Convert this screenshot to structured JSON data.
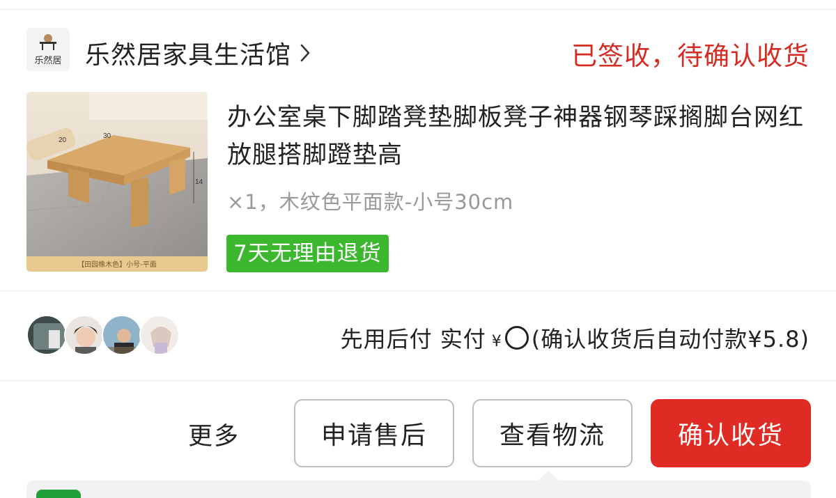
{
  "shop": {
    "logo_text": "乐然居",
    "name": "乐然居家具生活馆",
    "chevron_icon": "chevron-right-icon",
    "status": "已签收，待确认收货"
  },
  "product": {
    "title": "办公室桌下脚踏凳垫脚板凳子神器钢琴踩搁脚台网红放腿搭脚蹬垫高",
    "spec": "×1，木纹色平面款-小号30cm",
    "return_badge": "7天无理由退货",
    "thumb_dims": {
      "w": "30",
      "d": "20",
      "h": "14"
    },
    "thumb_caption": "【田园橡木色】小号-平面"
  },
  "payment": {
    "text_prefix": "先用后付 实付",
    "currency": "¥",
    "text_suffix": "(确认收货后自动付款¥5.8)"
  },
  "actions": {
    "more": "更多",
    "after_sale": "申请售后",
    "logistics": "查看物流",
    "confirm": "确认收货"
  },
  "colors": {
    "status_red": "#d42b22",
    "confirm_red": "#e02b24",
    "badge_green": "#3bb82e"
  }
}
